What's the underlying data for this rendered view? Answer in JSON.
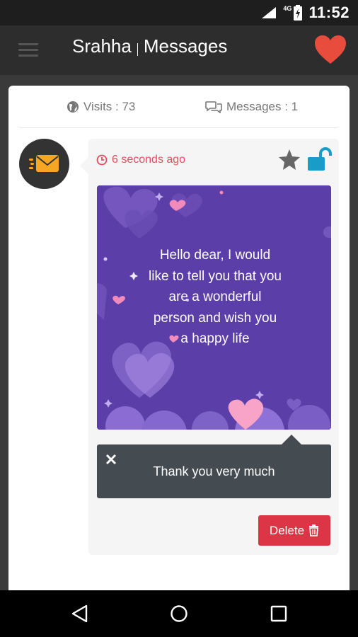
{
  "status_bar": {
    "network": "4G",
    "time": "11:52"
  },
  "app_bar": {
    "title_left": "Srahha",
    "title_right": "Messages",
    "accent_color": "#e74c3c"
  },
  "stats": {
    "visits_label": "Visits : 73",
    "messages_label": "Messages : 1"
  },
  "message": {
    "timestamp": "6 seconds ago",
    "timestamp_color": "#e84a5f",
    "body": "Hello dear, I would like to tell you that you are a wonderful person and wish you a happy life",
    "reply": "Thank you very much",
    "delete_label": "Delete",
    "delete_color": "#dc3545",
    "lock_color": "#1a9cc9"
  },
  "icons": {
    "menu": "menu-icon",
    "heart": "heart-icon",
    "globe": "globe-icon",
    "chat": "chat-icon",
    "clock": "clock-icon",
    "star": "star-icon",
    "lock": "unlock-icon",
    "trash": "trash-icon",
    "close": "close-icon",
    "envelope": "envelope-icon"
  }
}
